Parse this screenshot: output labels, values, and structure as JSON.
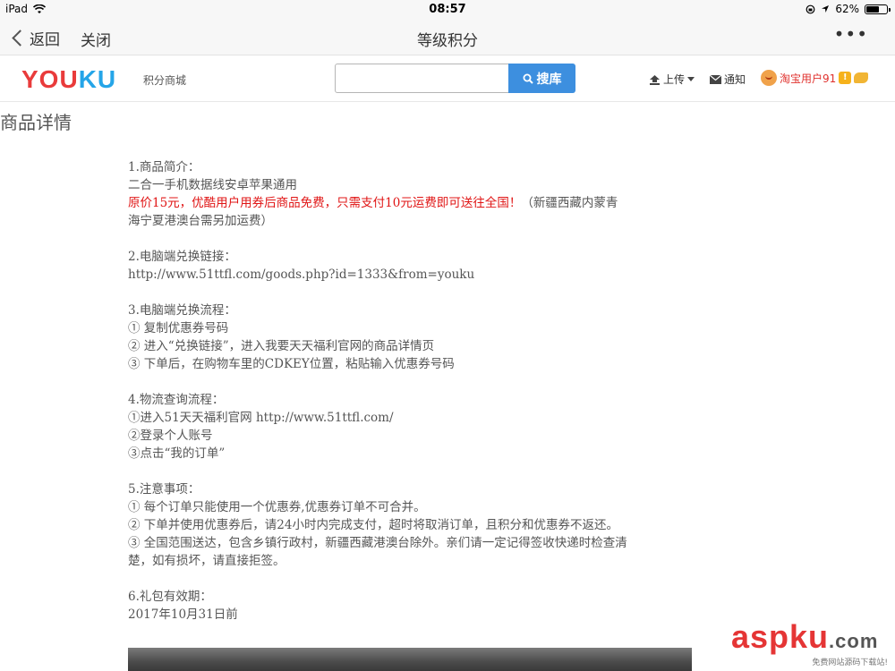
{
  "status_bar": {
    "device": "iPad",
    "time": "08:57",
    "battery": "62%",
    "battery_level": 0.62
  },
  "nav": {
    "back_label": "返回",
    "close_label": "关闭",
    "title": "等级积分",
    "more_label": "•••"
  },
  "header": {
    "logo_a": "YOU",
    "logo_b": "KU",
    "subtitle": "积分商城",
    "search_placeholder": "",
    "search_button": "搜库",
    "upload_label": "上传",
    "notify_label": "通知",
    "username": "淘宝用户91"
  },
  "page": {
    "section_title": "商品详情",
    "s1_heading": "1.商品简介：",
    "s1_line1": "二合一手机数据线安卓苹果通用",
    "s1_red": "原价15元，优酷用户用券后商品免费，只需支付10元运费即可送往全国！",
    "s1_note": "（新疆西藏内蒙青海宁夏港澳台需另加运费）",
    "s2_heading": "2.电脑端兑换链接：",
    "s2_link": "http://www.51ttfl.com/goods.php?id=1333&from=youku",
    "s3_heading": "3.电脑端兑换流程：",
    "s3_step1": "① 复制优惠券号码",
    "s3_step2": "② 进入“兑换链接”，进入我要天天福利官网的商品详情页",
    "s3_step3": "③ 下单后，在购物车里的CDKEY位置，粘贴输入优惠券号码",
    "s4_heading": "4.物流查询流程：",
    "s4_step1": "①进入51天天福利官网  http://www.51ttfl.com/",
    "s4_step2": "②登录个人账号",
    "s4_step3": "③点击“我的订单”",
    "s5_heading": "5.注意事项：",
    "s5_item1": "① 每个订单只能使用一个优惠券,优惠券订单不可合并。",
    "s5_item2": "② 下单并使用优惠券后，请24小时内完成支付，超时将取消订单，且积分和优惠券不返还。",
    "s5_item3": "③ 全国范围送达，包含乡镇行政村，新疆西藏港澳台除外。亲们请一定记得签收快递时检查清楚，如有损坏，请直接拒签。",
    "s6_heading": "6.礼包有效期：",
    "s6_date": "2017年10月31日前"
  },
  "watermark": {
    "main": "aspku",
    "suffix": ".com",
    "sub": "免费网站源码下载站!"
  }
}
